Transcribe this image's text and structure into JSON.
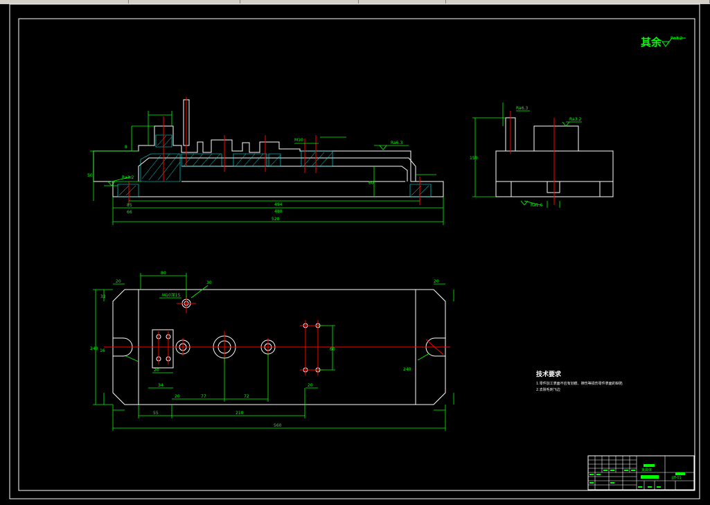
{
  "roughness_note": {
    "label": "其余",
    "value": "Ra3.2"
  },
  "technical_requirements": {
    "title": "技术要求",
    "items": [
      "1.零件加工表面不应有划痕、擦伤等损伤零件表面的缺陷",
      "2.去除毛刺飞边"
    ]
  },
  "front_view": {
    "dims": [
      "494",
      "480",
      "520",
      "85",
      "66",
      "50",
      "60",
      "8",
      "M10",
      "Ra6.3",
      "Ra3.2"
    ]
  },
  "side_view": {
    "dims": [
      "150",
      "Ra3.2",
      "Ra6.3",
      "Ra1.6"
    ]
  },
  "top_view": {
    "dims": [
      "80",
      "M10深15",
      "30",
      "560",
      "20",
      "16",
      "32",
      "240",
      "55",
      "210",
      "20",
      "77",
      "72",
      "34",
      "20",
      "60",
      "20",
      "20",
      "240"
    ]
  },
  "title_block": {
    "name": "夹具体",
    "code": "JJT-01"
  },
  "colors": {
    "lines": "#ffffff",
    "dims": "#00ff00",
    "center": "#ff0000",
    "hatch": "#00ffff",
    "frame": "#ffffff"
  }
}
